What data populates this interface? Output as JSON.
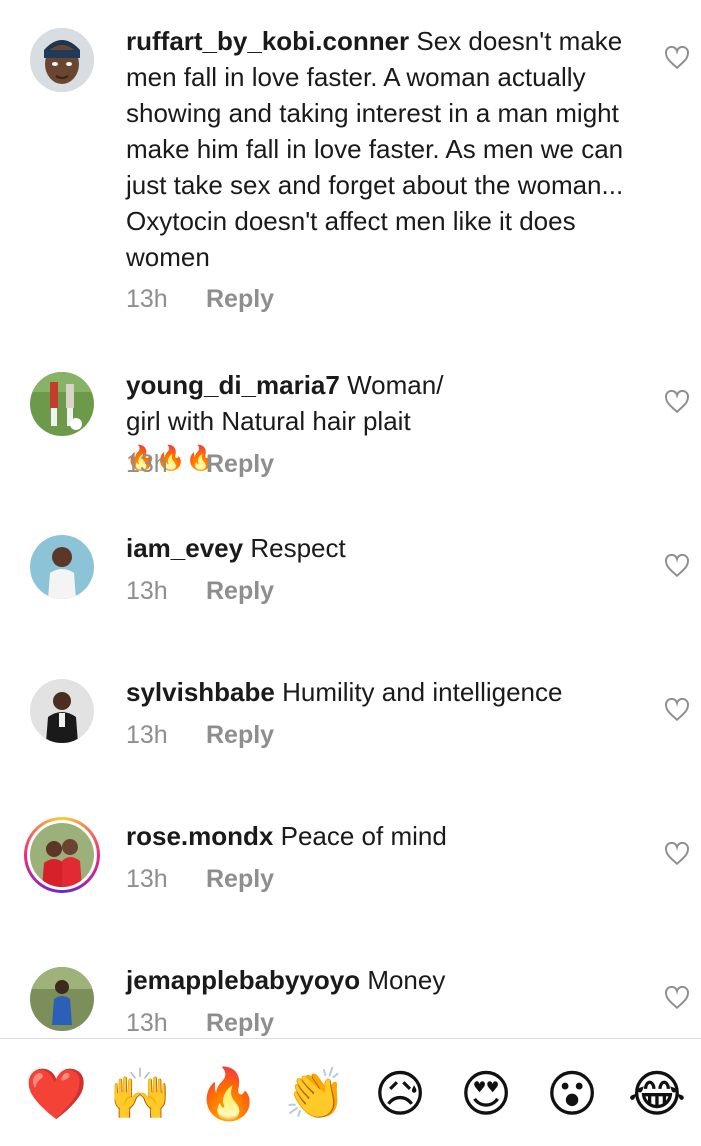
{
  "comments": [
    {
      "username": "ruffart_by_kobi.conner",
      "text": "Sex doesn't make men fall in love faster. A woman actually showing and taking interest in a man might make him fall in love faster. As men we can just take sex and forget about the woman... Oxytocin doesn't affect men like it does women",
      "time": "13h",
      "reply": "Reply"
    },
    {
      "username": "young_di_maria7",
      "text": "Woman/ girl with Natural hair plait",
      "fire": "🔥🔥🔥",
      "time": "13h",
      "reply": "Reply"
    },
    {
      "username": "iam_evey",
      "text": "Respect",
      "time": "13h",
      "reply": "Reply"
    },
    {
      "username": "sylvishbabe",
      "text": "Humility and intelligence",
      "time": "13h",
      "reply": "Reply"
    },
    {
      "username": "rose.mondx",
      "text": "Peace of mind",
      "time": "13h",
      "reply": "Reply"
    },
    {
      "username": "jemapplebabyyoyo",
      "text": "Money",
      "time": "13h",
      "reply": "Reply"
    }
  ],
  "emoji_bar": [
    {
      "name": "heart",
      "char": "❤️"
    },
    {
      "name": "raising-hands",
      "char": "🙌"
    },
    {
      "name": "fire",
      "char": "🔥"
    },
    {
      "name": "clapping-hands",
      "char": "👏"
    },
    {
      "name": "sad-face",
      "char": "😥"
    },
    {
      "name": "heart-eyes",
      "char": "😍"
    },
    {
      "name": "surprised-face",
      "char": "😮"
    },
    {
      "name": "tears-of-joy",
      "char": "😂"
    }
  ]
}
